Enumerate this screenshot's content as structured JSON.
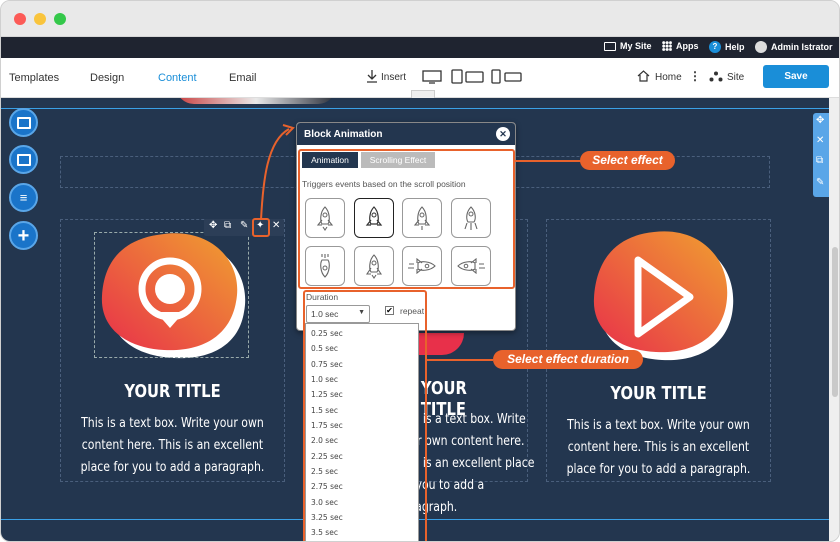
{
  "admin_bar": {
    "my_site": "My Site",
    "apps": "Apps",
    "help": "Help",
    "user": "Admin Istrator"
  },
  "toolbar": {
    "nav": [
      "Templates",
      "Design",
      "Content",
      "Email"
    ],
    "active_nav": "Content",
    "insert": "Insert",
    "home": "Home",
    "site": "Site",
    "save": "Save"
  },
  "cards": [
    {
      "title": "YOUR TITLE",
      "text": "This is a text box. Write your own content here. This is an excellent place for you to add a paragraph."
    },
    {
      "title": "YOUR TITLE",
      "text": "This is a text box. Write your own content here. This is an excellent place for you to add a paragraph."
    },
    {
      "title": "YOUR TITLE",
      "text": "This is a text box. Write your own content here. This is an excellent place for you to add a paragraph."
    }
  ],
  "modal": {
    "title": "Block Animation",
    "tab_animation": "Animation",
    "tab_scrolling": "Scrolling Effect",
    "description": "Triggers events based on the scroll position",
    "duration_label": "Duration",
    "duration_value": "1.0 sec",
    "repeat_label": "repeat",
    "repeat_checked": true
  },
  "duration_options": [
    "0.25 sec",
    "0.5 sec",
    "0.75 sec",
    "1.0 sec",
    "1.25 sec",
    "1.5 sec",
    "1.75 sec",
    "2.0 sec",
    "2.25 sec",
    "2.5 sec",
    "2.75 sec",
    "3.0 sec",
    "3.25 sec",
    "3.5 sec"
  ],
  "callouts": {
    "select_effect": "Select effect",
    "select_duration": "Select effect duration"
  },
  "colors": {
    "accent": "#1a8ed8",
    "callout": "#e8622c",
    "canvas_bg": "#23364f"
  }
}
